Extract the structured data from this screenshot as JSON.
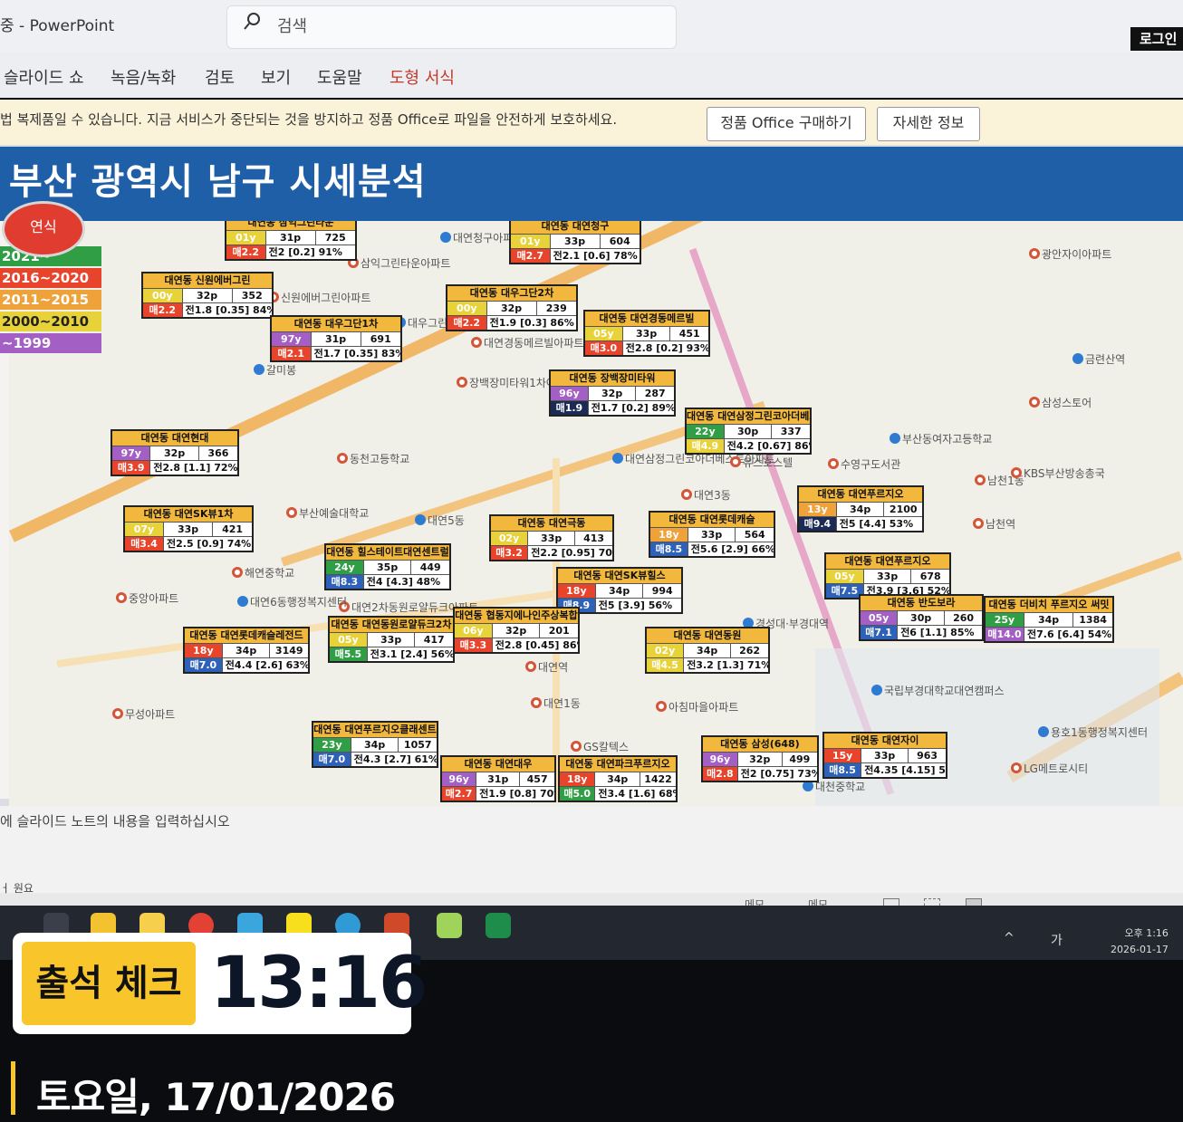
{
  "window": {
    "app_title": "중 - PowerPoint",
    "search_placeholder": "검색",
    "login_label": "로그인"
  },
  "ribbon": {
    "tabs": [
      "슬라이드 쇼",
      "녹음/녹화",
      "검토",
      "보기",
      "도움말",
      "도형 서식"
    ]
  },
  "notice": {
    "message": "법 복제품일 수 있습니다. 지금 서비스가 중단되는 것을 방지하고 정품 Office로 파일을 안전하게 보호하세요.",
    "buy_button": "정품 Office 구매하기",
    "info_button": "자세한 정보"
  },
  "slide": {
    "title": "부산 광역시 남구 시세분석",
    "legend_badge": "연식",
    "legend": [
      {
        "label": "2021~",
        "color": "#2f9e44"
      },
      {
        "label": "2016~2020",
        "color": "#e8432b"
      },
      {
        "label": "2011~2015",
        "color": "#f0a23a"
      },
      {
        "label": "2000~2010",
        "color": "#e8d23a"
      },
      {
        "label": "~1999",
        "color": "#a45fc4"
      }
    ],
    "map_labels": [
      "대연청구아파트",
      "삼익그린타운아파트",
      "신원에버그린아파트",
      "대우그린아파트",
      "대연경동메르빌아파트",
      "장백장미타워1차아파트",
      "갈미봉",
      "동천고등학교",
      "부산예술대학교",
      "대연삼정그린코아더베스트아파트",
      "유스호스텔",
      "대연3동",
      "대연5동",
      "해연중학교",
      "대연2차동원로얄듀크아파트",
      "대연6동행정복지센터",
      "대연1동",
      "대연역",
      "경성대·부경대역",
      "삼성스토어",
      "수영구도서관",
      "부산동여자고등학교",
      "남천1동",
      "KBS부산방송총국",
      "금련산역",
      "광안자이아파트",
      "남천역",
      "국립부경대학교대연캠퍼스",
      "아침마을아파트",
      "GS칼텍스",
      "대천중학교",
      "무성아파트",
      "중앙아파트",
      "용호1동행정복지센터",
      "LG메트로시티"
    ],
    "apartments": [
      {
        "name": "대연동 삼익그린타운",
        "age": "01y",
        "size": "31p",
        "units": "725",
        "sale": "매2.2",
        "trade": "전2 [0.2] 91%",
        "age_color": "#e8d23a",
        "sale_color": "#e8432b"
      },
      {
        "name": "대연동 대연청구",
        "age": "01y",
        "size": "33p",
        "units": "604",
        "sale": "매2.7",
        "trade": "전2.1 [0.6] 78%",
        "age_color": "#e8d23a",
        "sale_color": "#e8432b"
      },
      {
        "name": "대연동 신원에버그린",
        "age": "00y",
        "size": "32p",
        "units": "352",
        "sale": "매2.2",
        "trade": "전1.8 [0.35] 84%",
        "age_color": "#e8d23a",
        "sale_color": "#e8432b"
      },
      {
        "name": "대연동 대우그단2차",
        "age": "00y",
        "size": "32p",
        "units": "239",
        "sale": "매2.2",
        "trade": "전1.9 [0.3] 86%",
        "age_color": "#e8d23a",
        "sale_color": "#e8432b"
      },
      {
        "name": "대연동 대우그단1차",
        "age": "97y",
        "size": "31p",
        "units": "691",
        "sale": "매2.1",
        "trade": "전1.7 [0.35] 83%",
        "age_color": "#a45fc4",
        "sale_color": "#e8432b"
      },
      {
        "name": "대연동 대연경동메르빌",
        "age": "05y",
        "size": "33p",
        "units": "451",
        "sale": "매3.0",
        "trade": "전2.8 [0.2] 93%",
        "age_color": "#e8d23a",
        "sale_color": "#e8432b"
      },
      {
        "name": "대연동 장백장미타워",
        "age": "96y",
        "size": "32p",
        "units": "287",
        "sale": "매1.9",
        "trade": "전1.7 [0.2] 89%",
        "age_color": "#a45fc4",
        "sale_color": "#1b2b55"
      },
      {
        "name": "대연동 대연삼정그린코아더베스트",
        "age": "22y",
        "size": "30p",
        "units": "337",
        "sale": "매4.9",
        "trade": "전4.2 [0.67] 86%",
        "age_color": "#2f9e44",
        "sale_color": "#e8d23a"
      },
      {
        "name": "대연동 대연현대",
        "age": "97y",
        "size": "32p",
        "units": "366",
        "sale": "매3.9",
        "trade": "전2.8 [1.1] 72%",
        "age_color": "#a45fc4",
        "sale_color": "#e8432b"
      },
      {
        "name": "대연동 대연SK뷰1차",
        "age": "07y",
        "size": "33p",
        "units": "421",
        "sale": "매3.4",
        "trade": "전2.5 [0.9] 74%",
        "age_color": "#e8d23a",
        "sale_color": "#e8432b"
      },
      {
        "name": "대연동 대연극동",
        "age": "02y",
        "size": "33p",
        "units": "413",
        "sale": "매3.2",
        "trade": "전2.2 [0.95] 70%",
        "age_color": "#e8d23a",
        "sale_color": "#e8432b"
      },
      {
        "name": "대연동 대연롯데캐슬",
        "age": "18y",
        "size": "33p",
        "units": "564",
        "sale": "매8.5",
        "trade": "전5.6 [2.9] 66%",
        "age_color": "#f0a23a",
        "sale_color": "#2e62b8"
      },
      {
        "name": "대연동 대연푸르지오",
        "age": "13y",
        "size": "34p",
        "units": "2100",
        "sale": "매9.4",
        "trade": "전5 [4.4] 53%",
        "age_color": "#f0a23a",
        "sale_color": "#1b2b55"
      },
      {
        "name": "대연동 힐스테이트대연센트럴",
        "age": "24y",
        "size": "35p",
        "units": "449",
        "sale": "매8.3",
        "trade": "전4 [4.3] 48%",
        "age_color": "#2f9e44",
        "sale_color": "#2e62b8"
      },
      {
        "name": "대연동 대연SK뷰힐스",
        "age": "18y",
        "size": "34p",
        "units": "994",
        "sale": "매8.9",
        "trade": "전5 [3.9] 56%",
        "age_color": "#e8432b",
        "sale_color": "#2e62b8"
      },
      {
        "name": "대연동 대연푸르지오",
        "age": "05y",
        "size": "33p",
        "units": "678",
        "sale": "매7.5",
        "trade": "전3.9 [3.6] 52%",
        "age_color": "#e8d23a",
        "sale_color": "#2e62b8"
      },
      {
        "name": "대연동 반도보라",
        "age": "05y",
        "size": "30p",
        "units": "260",
        "sale": "매7.1",
        "trade": "전6 [1.1] 85%",
        "age_color": "#a45fc4",
        "sale_color": "#2e62b8"
      },
      {
        "name": "대연동 더비치 푸르지오 써밋",
        "age": "25y",
        "size": "34p",
        "units": "1384",
        "sale": "매14.0",
        "trade": "전7.6 [6.4] 54%",
        "age_color": "#2f9e44",
        "sale_color": "#a45fc4"
      },
      {
        "name": "대연동 대연롯데캐슬레전드",
        "age": "18y",
        "size": "34p",
        "units": "3149",
        "sale": "매7.0",
        "trade": "전4.4 [2.6] 63%",
        "age_color": "#e8432b",
        "sale_color": "#2e62b8"
      },
      {
        "name": "대연동 대연동원로얄듀크2차",
        "age": "05y",
        "size": "33p",
        "units": "417",
        "sale": "매5.5",
        "trade": "전3.1 [2.4] 56%",
        "age_color": "#e8d23a",
        "sale_color": "#2f9e44"
      },
      {
        "name": "대연동 협동지에나인주상복합",
        "age": "06y",
        "size": "32p",
        "units": "201",
        "sale": "매3.3",
        "trade": "전2.8 [0.45] 86%",
        "age_color": "#e8d23a",
        "sale_color": "#e8432b"
      },
      {
        "name": "대연동 대연동원",
        "age": "02y",
        "size": "34p",
        "units": "262",
        "sale": "매4.5",
        "trade": "전3.2 [1.3] 71%",
        "age_color": "#e8d23a",
        "sale_color": "#e8d23a"
      },
      {
        "name": "대연동 대연푸르지오클래센트",
        "age": "23y",
        "size": "34p",
        "units": "1057",
        "sale": "매7.0",
        "trade": "전4.3 [2.7] 61%",
        "age_color": "#2f9e44",
        "sale_color": "#2e62b8"
      },
      {
        "name": "대연동 대연대우",
        "age": "96y",
        "size": "31p",
        "units": "457",
        "sale": "매2.7",
        "trade": "전1.9 [0.8] 70%",
        "age_color": "#a45fc4",
        "sale_color": "#e8432b"
      },
      {
        "name": "대연동 대연파크푸르지오",
        "age": "18y",
        "size": "34p",
        "units": "1422",
        "sale": "매5.0",
        "trade": "전3.4 [1.6] 68%",
        "age_color": "#e8432b",
        "sale_color": "#2f9e44"
      },
      {
        "name": "대연동 삼성(648)",
        "age": "96y",
        "size": "32p",
        "units": "499",
        "sale": "매2.8",
        "trade": "전2 [0.75] 73%",
        "age_color": "#a45fc4",
        "sale_color": "#e8432b"
      },
      {
        "name": "대연동 대연자이",
        "age": "15y",
        "size": "33p",
        "units": "963",
        "sale": "매8.5",
        "trade": "전4.35 [4.15] 51%",
        "age_color": "#e8432b",
        "sale_color": "#2e62b8"
      }
    ]
  },
  "notes": {
    "placeholder": "에 슬라이드 노트의 내용을 입력하십시오"
  },
  "statusbar": {
    "left": "ㅓ 원요",
    "notes_label": "메모",
    "comments_label": "메모"
  },
  "taskbar": {
    "time": "오후 1:16",
    "date": "2026-01-17",
    "ime": "가"
  },
  "overlay": {
    "tag": "출석 체크",
    "time": "13:16",
    "date": "토요일, 17/01/2026"
  }
}
